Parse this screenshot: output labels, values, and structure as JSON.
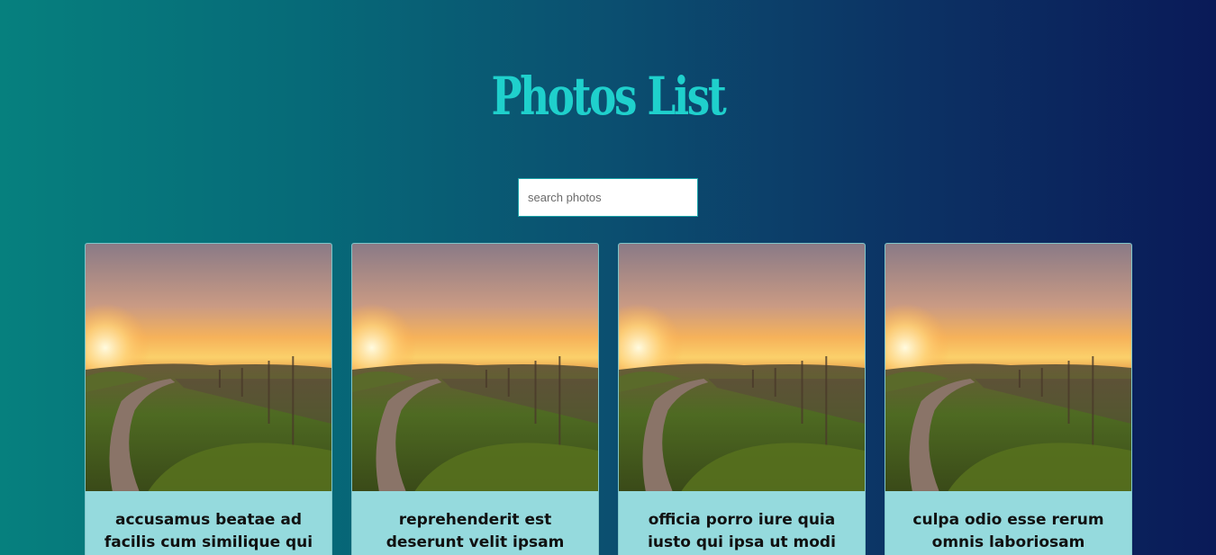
{
  "header": {
    "title": "Photos List"
  },
  "search": {
    "placeholder": "search photos",
    "value": ""
  },
  "photos": [
    {
      "caption": "accusamus beatae ad facilis cum similique qui sunt"
    },
    {
      "caption": "reprehenderit est deserunt velit ipsam"
    },
    {
      "caption": "officia porro iure quia iusto qui ipsa ut modi"
    },
    {
      "caption": "culpa odio esse rerum omnis laboriosam voluptate"
    }
  ],
  "colors": {
    "title": "#1fd0cc",
    "caption_bg": "#95dadd",
    "bg_start": "#06807e",
    "bg_end": "#0a1a58"
  }
}
